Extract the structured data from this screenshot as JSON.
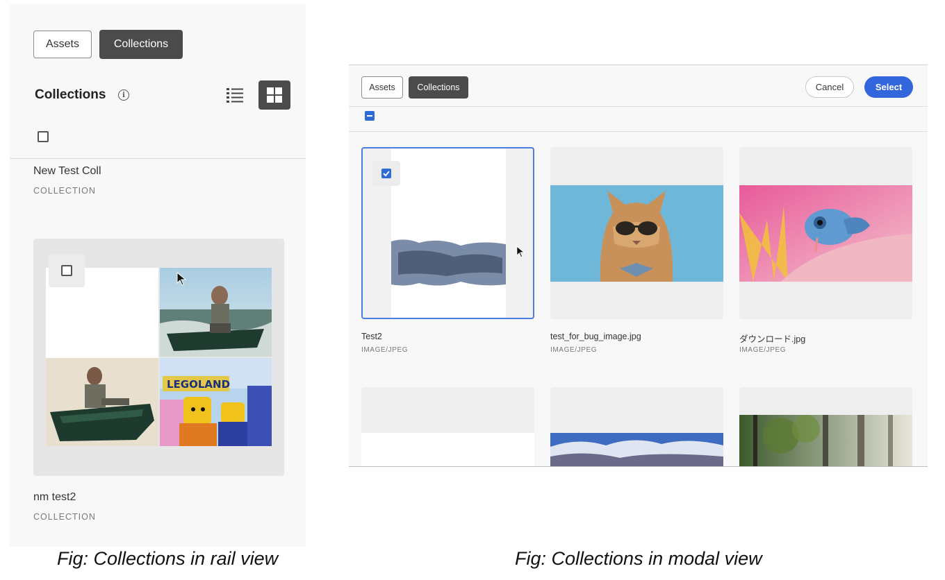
{
  "rail": {
    "tabs": {
      "assets": "Assets",
      "collections": "Collections"
    },
    "title": "Collections",
    "info_glyph": "i",
    "icons": {
      "info": "info-icon",
      "list_view": "list-view-icon",
      "grid_view": "grid-view-icon"
    },
    "items": [
      {
        "name": "New Test Coll",
        "type": "COLLECTION"
      },
      {
        "name": "nm test2",
        "type": "COLLECTION"
      }
    ],
    "legoland_text": "LEGOLAND"
  },
  "modal": {
    "tabs": {
      "assets": "Assets",
      "collections": "Collections"
    },
    "cancel": "Cancel",
    "select": "Select",
    "accent_color": "#3366dd",
    "items": [
      {
        "name": "Test2",
        "type": "IMAGE/JPEG",
        "selected": true
      },
      {
        "name": "test_for_bug_image.jpg",
        "type": "IMAGE/JPEG",
        "selected": false
      },
      {
        "name": "ダウンロード.jpg",
        "type": "IMAGE/JPEG",
        "selected": false
      }
    ]
  },
  "captions": {
    "rail": "Fig: Collections in rail view",
    "modal": "Fig: Collections in modal view"
  }
}
